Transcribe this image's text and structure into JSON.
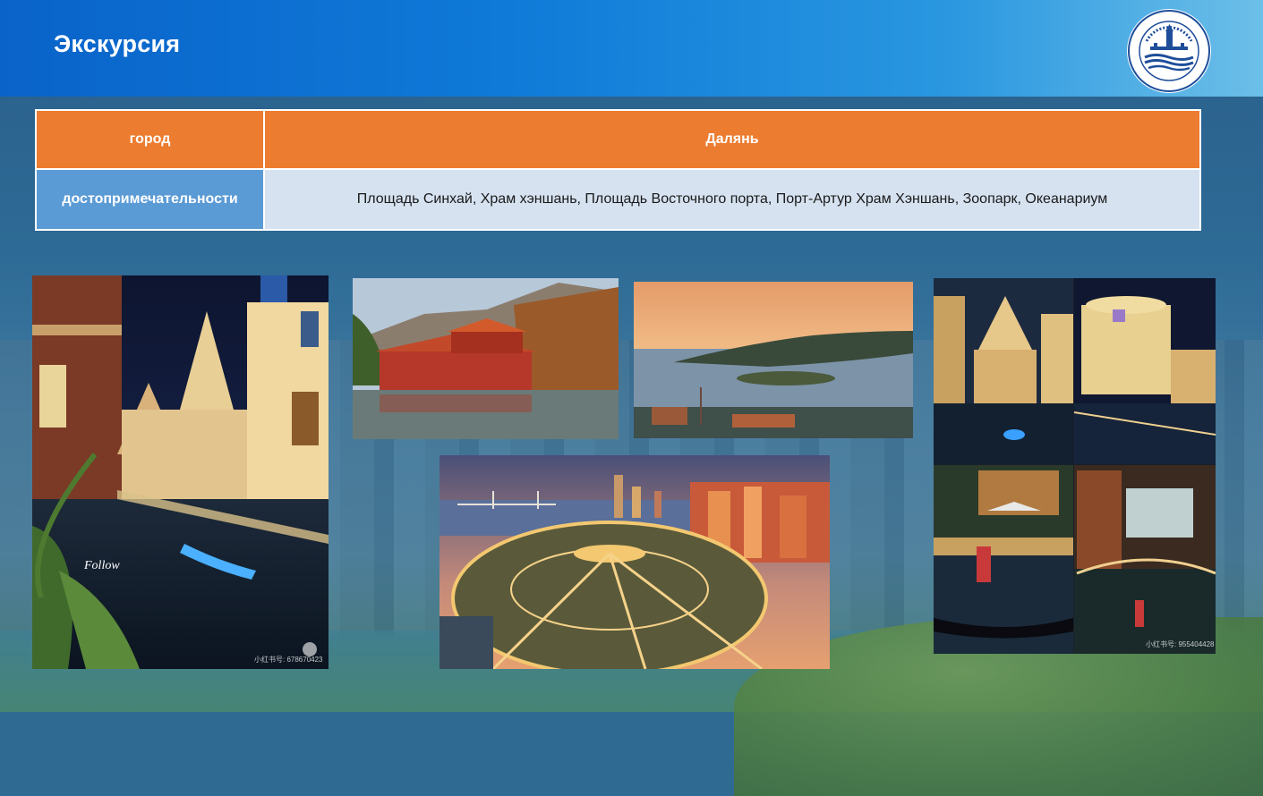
{
  "slide": {
    "title": "Экскурсия"
  },
  "table": {
    "header": {
      "label": "город",
      "value": "Далянь"
    },
    "row": {
      "label": "достопримечательности",
      "value": "Площадь Синхай,  Храм хэншань, Площадь Восточного порта,  Порт-Артур Храм Хэншань, Зоопарк, Океанариум"
    }
  },
  "photos": {
    "canal_night": {
      "watermark": "小红书号: 678670423",
      "sign": "Follow"
    },
    "temple_lake": {},
    "sea_sunset": {},
    "xinghai_square": {},
    "venice_collage": {
      "watermark": "小红书号: 955404428"
    }
  },
  "colors": {
    "header_blue": "#0a63c9",
    "table_orange": "#ec7c30",
    "table_label_blue": "#5b9bd5",
    "table_value_bg": "#d6e2f0"
  }
}
